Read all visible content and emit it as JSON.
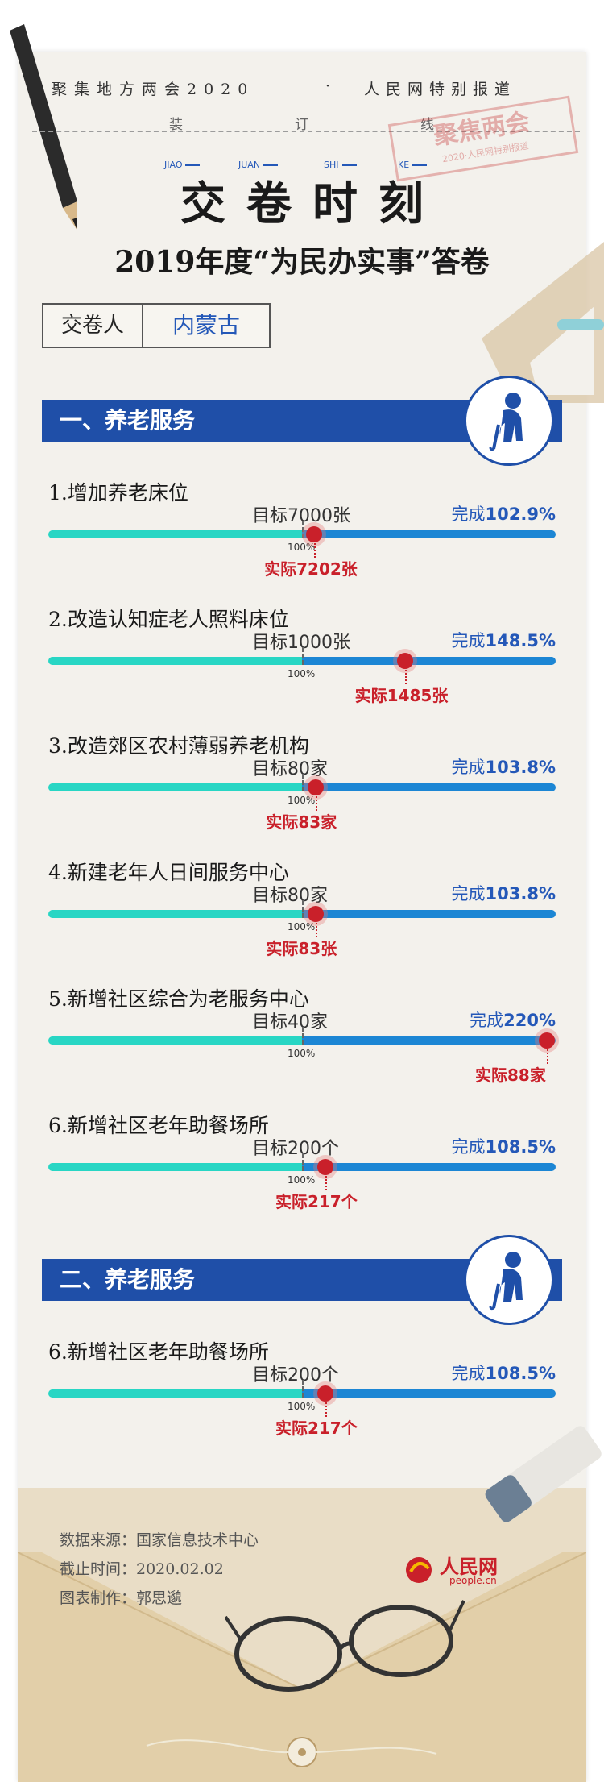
{
  "header": {
    "series_title": "聚集地方两会2020",
    "dot": "·",
    "special": "人民网特别报道",
    "binding": [
      "装",
      "订",
      "线"
    ],
    "stamp_main": "聚焦两会",
    "stamp_sub": "2020·人民网特别报道"
  },
  "title": {
    "pinyin": [
      "JIAO",
      "JUAN",
      "SHI",
      "KE"
    ],
    "main": "交卷时刻",
    "sub": "2019年度“为民办实事”答卷"
  },
  "submitter": {
    "label": "交卷人",
    "value": "内蒙古"
  },
  "sections": [
    {
      "heading": "一、养老服务",
      "items": [
        {
          "title": "1.增加养老床位",
          "target": "目标7000张",
          "complete_label": "完成",
          "complete_pct": "102.9%",
          "mark100": "100%",
          "actual": "实际7202张",
          "ratio": 1.029
        },
        {
          "title": "2.改造认知症老人照料床位",
          "target": "目标1000张",
          "complete_label": "完成",
          "complete_pct": "148.5%",
          "mark100": "100%",
          "actual": "实际1485张",
          "ratio": 1.485
        },
        {
          "title": "3.改造郊区农村薄弱养老机构",
          "target": "目标80家",
          "complete_label": "完成",
          "complete_pct": "103.8%",
          "mark100": "100%",
          "actual": "实际83家",
          "ratio": 1.038
        },
        {
          "title": "4.新建老年人日间服务中心",
          "target": "目标80家",
          "complete_label": "完成",
          "complete_pct": "103.8%",
          "mark100": "100%",
          "actual": "实际83张",
          "ratio": 1.038
        },
        {
          "title": "5.新增社区综合为老服务中心",
          "target": "目标40家",
          "complete_label": "完成",
          "complete_pct": "220%",
          "mark100": "100%",
          "actual": "实际88家",
          "ratio": 2.2
        },
        {
          "title": "6.新增社区老年助餐场所",
          "target": "目标200个",
          "complete_label": "完成",
          "complete_pct": "108.5%",
          "mark100": "100%",
          "actual": "实际217个",
          "ratio": 1.085
        }
      ]
    },
    {
      "heading": "二、养老服务",
      "items": [
        {
          "title": "6.新增社区老年助餐场所",
          "target": "目标200个",
          "complete_label": "完成",
          "complete_pct": "108.5%",
          "mark100": "100%",
          "actual": "实际217个",
          "ratio": 1.085
        }
      ]
    }
  ],
  "footer": {
    "source": "数据来源：国家信息技术中心",
    "deadline": "截止时间：2020.02.02",
    "author": "图表制作：郭思邈",
    "logo_text": "人民网",
    "logo_url": "people.cn"
  },
  "colors": {
    "section_blue": "#1f4fa8",
    "bar_teal": "#28d6c4",
    "bar_blue": "#1c86d4",
    "actual_red": "#c9202a",
    "complete_blue": "#2458b8"
  }
}
